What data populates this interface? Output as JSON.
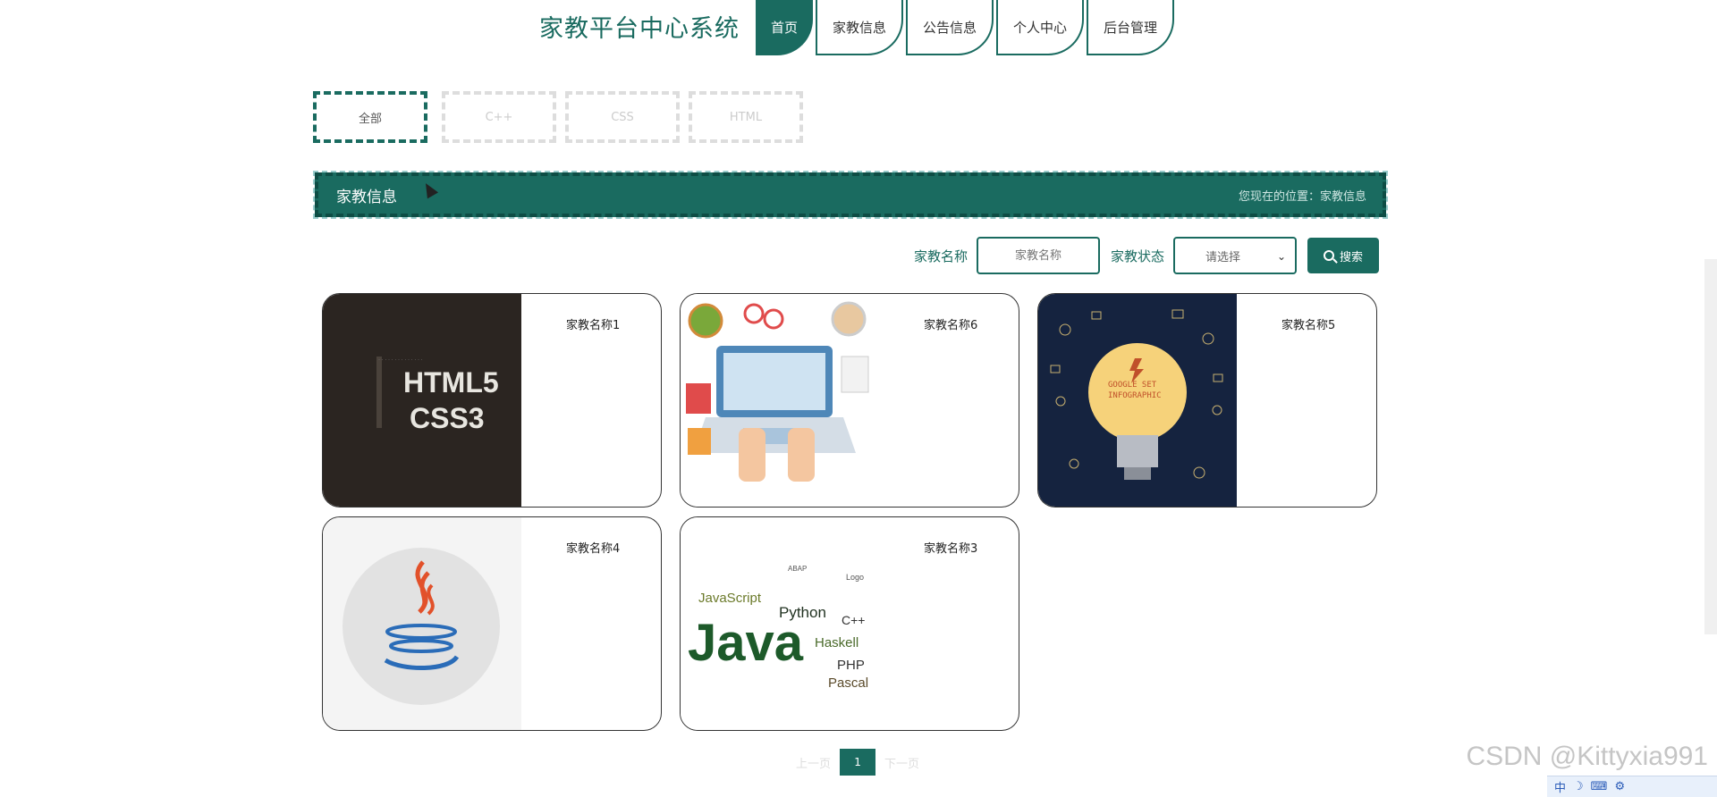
{
  "header": {
    "site_title": "家教平台中心系统"
  },
  "nav": [
    {
      "label": "首页",
      "active": true
    },
    {
      "label": "家教信息"
    },
    {
      "label": "公告信息"
    },
    {
      "label": "个人中心"
    },
    {
      "label": "后台管理"
    }
  ],
  "categories": [
    {
      "label": "全部",
      "active": true
    },
    {
      "label": "C++"
    },
    {
      "label": "CSS"
    },
    {
      "label": "HTML"
    }
  ],
  "section": {
    "title": "家教信息",
    "breadcrumb": "您现在的位置：家教信息"
  },
  "search": {
    "name_label": "家教名称",
    "name_placeholder": "家教名称",
    "status_label": "家教状态",
    "status_selected": "请选择",
    "button_label": "搜索"
  },
  "cards": [
    {
      "name": "家教名称1",
      "image": "HTML5 CSS3 book cover"
    },
    {
      "name": "家教名称6",
      "image": "laptop hands illustration"
    },
    {
      "name": "家教名称5",
      "image": "lightbulb infographic"
    },
    {
      "name": "家教名称4",
      "image": "Java logo"
    },
    {
      "name": "家教名称3",
      "image": "programming word cloud"
    }
  ],
  "pagination": {
    "prev": "上一页",
    "current": "1",
    "next": "下一页"
  },
  "watermark": "CSDN @Kittyxia991",
  "colors": {
    "primary": "#1a6b60"
  }
}
